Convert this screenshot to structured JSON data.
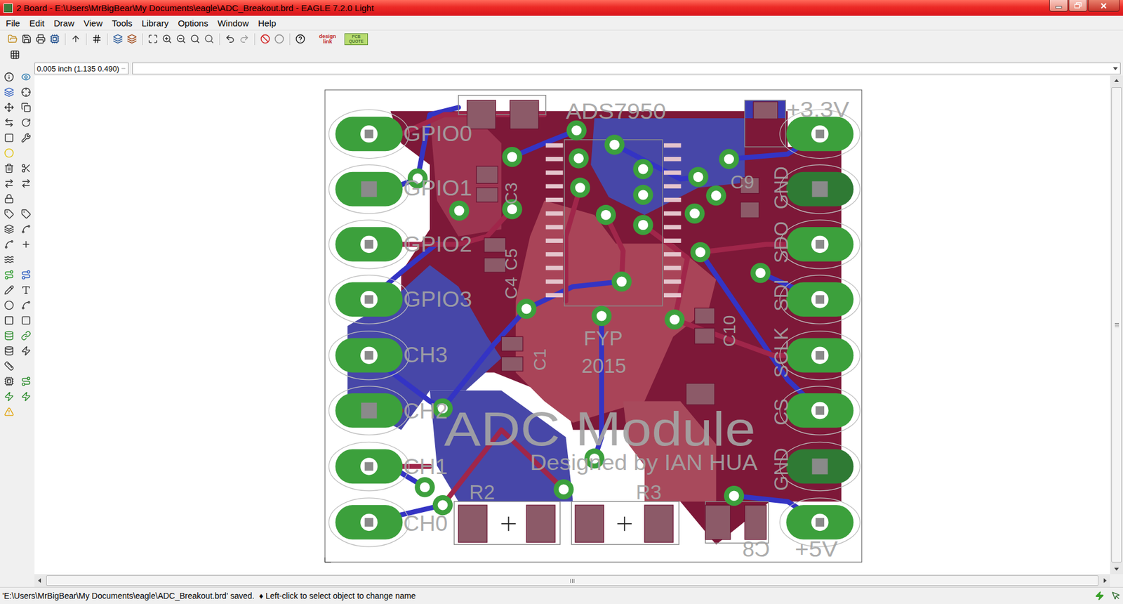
{
  "window": {
    "title": "2 Board - E:\\Users\\MrBigBear\\My Documents\\eagle\\ADC_Breakout.brd - EAGLE 7.2.0 Light"
  },
  "menu": [
    "File",
    "Edit",
    "Draw",
    "View",
    "Tools",
    "Library",
    "Options",
    "Window",
    "Help"
  ],
  "toolbar": {
    "logos": [
      "design link",
      "PCB QUOTE"
    ]
  },
  "coordinates": "0.005 inch (1.135 0.490)",
  "board": {
    "labels": [
      {
        "text": "ADS7950",
        "kind": "horizontal"
      },
      {
        "text": "+3.3V",
        "kind": "horizontal"
      },
      {
        "text": "GPIO0",
        "kind": "horizontal"
      },
      {
        "text": "GPIO1",
        "kind": "horizontal"
      },
      {
        "text": "GPIO2",
        "kind": "horizontal"
      },
      {
        "text": "GPIO3",
        "kind": "horizontal"
      },
      {
        "text": "CH3",
        "kind": "horizontal"
      },
      {
        "text": "CH2",
        "kind": "horizontal"
      },
      {
        "text": "CH1",
        "kind": "horizontal"
      },
      {
        "text": "CH0",
        "kind": "horizontal"
      },
      {
        "text": "GND",
        "kind": "vertical"
      },
      {
        "text": "SDO",
        "kind": "vertical"
      },
      {
        "text": "SDI",
        "kind": "vertical"
      },
      {
        "text": "SCLK",
        "kind": "vertical"
      },
      {
        "text": "CS",
        "kind": "vertical"
      },
      {
        "text": "GND",
        "kind": "vertical"
      },
      {
        "text": "+5V",
        "kind": "horizontal"
      },
      {
        "text": "C8",
        "kind": "mirrored"
      },
      {
        "text": "R2",
        "kind": "horizontal"
      },
      {
        "text": "R3",
        "kind": "horizontal"
      },
      {
        "text": "C9",
        "kind": "horizontal"
      },
      {
        "text": "C3",
        "kind": "vertical"
      },
      {
        "text": "C5",
        "kind": "vertical"
      },
      {
        "text": "C4",
        "kind": "vertical"
      },
      {
        "text": "C1",
        "kind": "vertical"
      },
      {
        "text": "C10",
        "kind": "vertical"
      },
      {
        "text": "FYP",
        "kind": "horizontal"
      },
      {
        "text": "2015",
        "kind": "horizontal"
      },
      {
        "text": "ADC Module",
        "kind": "horizontal"
      },
      {
        "text": "Designed by IAN HUA",
        "kind": "horizontal"
      }
    ]
  },
  "status_bar": {
    "message": "'E:\\Users\\MrBigBear\\My Documents\\eagle\\ADC_Breakout.brd' saved.",
    "hint": "♦ Left-click to select object to change name"
  }
}
